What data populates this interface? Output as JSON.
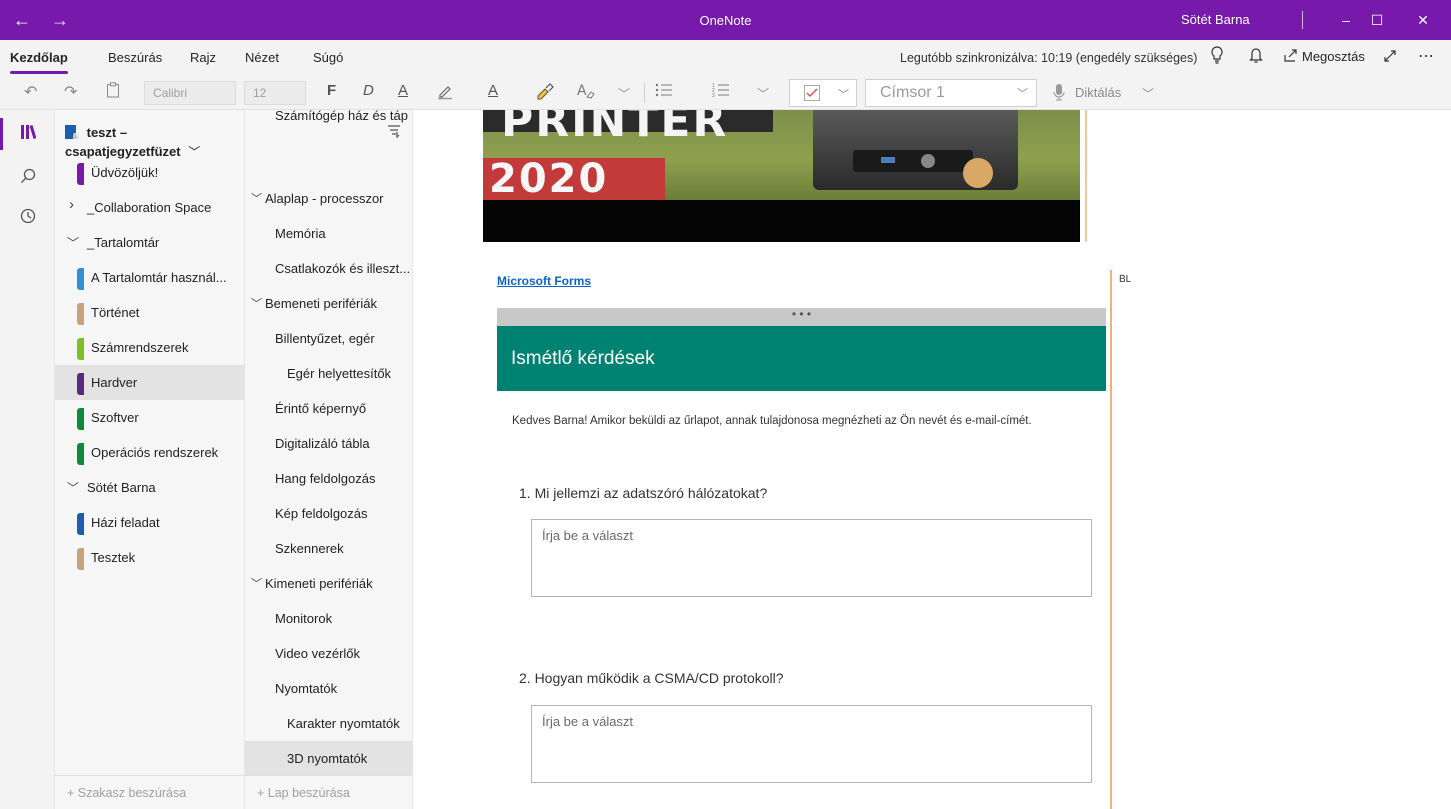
{
  "titlebar": {
    "app_title": "OneNote",
    "user_name": "Sötét Barna",
    "back_icon": "←",
    "forward_icon": "→",
    "minimize_icon": "–",
    "maximize_icon": "☐",
    "close_icon": "✕"
  },
  "menu": {
    "tabs": [
      "Kezdőlap",
      "Beszúrás",
      "Rajz",
      "Nézet",
      "Súgó"
    ],
    "sync_status": "Legutóbb szinkronizálva: 10:19 (engedély szükséges)",
    "share_label": "Megosztás"
  },
  "toolbar": {
    "font_name": "Calibri",
    "font_size": "12",
    "bold_label": "F",
    "italic_label": "D",
    "underline_label": "A",
    "font_color_label": "A",
    "style_value": "Címsor 1",
    "dictate_label": "Diktálás"
  },
  "notebook": {
    "name": "teszt – csapatjegyzetfüzet"
  },
  "sections": [
    {
      "label": "Üdvözöljük!",
      "color": "#7719aa",
      "indent": 1,
      "type": "section"
    },
    {
      "label": "_Collaboration Space",
      "indent": 0,
      "type": "group",
      "expanded": false
    },
    {
      "label": "_Tartalomtár",
      "indent": 0,
      "type": "group",
      "expanded": true
    },
    {
      "label": "A Tartalomtár használ...",
      "color": "#2f8fd8",
      "indent": 1,
      "type": "section"
    },
    {
      "label": "Történet",
      "color": "#c8a27a",
      "indent": 1,
      "type": "section"
    },
    {
      "label": "Számrendszerek",
      "color": "#7cc026",
      "indent": 1,
      "type": "section"
    },
    {
      "label": "Hardver",
      "color": "#5a2a7a",
      "indent": 1,
      "type": "section",
      "selected": true
    },
    {
      "label": "Szoftver",
      "color": "#0f8a3a",
      "indent": 1,
      "type": "section"
    },
    {
      "label": "Operációs rendszerek",
      "color": "#0f8a3a",
      "indent": 1,
      "type": "section"
    },
    {
      "label": "Sötét Barna",
      "indent": 0,
      "type": "group",
      "expanded": true
    },
    {
      "label": "Házi feladat",
      "color": "#1a5fb0",
      "indent": 1,
      "type": "section"
    },
    {
      "label": "Tesztek",
      "color": "#c8a27a",
      "indent": 1,
      "type": "section"
    }
  ],
  "add_section_label": "+ Szakasz beszúrása",
  "pages": [
    {
      "label": "Számítógép ház és táp...",
      "level": 1
    },
    {
      "label": "Alaplap - processzor",
      "level": 0,
      "expanded": true
    },
    {
      "label": "Memória",
      "level": 1
    },
    {
      "label": "Csatlakozók és illeszt...",
      "level": 1
    },
    {
      "label": "Bemeneti perifériák",
      "level": 0,
      "expanded": true
    },
    {
      "label": "Billentyűzet, egér",
      "level": 1
    },
    {
      "label": "Egér helyettesítők",
      "level": 2
    },
    {
      "label": "Érintő képernyő",
      "level": 1
    },
    {
      "label": "Digitalizáló tábla",
      "level": 1
    },
    {
      "label": "Hang feldolgozás",
      "level": 1
    },
    {
      "label": "Kép feldolgozás",
      "level": 1
    },
    {
      "label": "Szkennerek",
      "level": 1
    },
    {
      "label": "Kimeneti perifériák",
      "level": 0,
      "expanded": true
    },
    {
      "label": "Monitorok",
      "level": 1
    },
    {
      "label": "Video vezérlők",
      "level": 1
    },
    {
      "label": "Nyomtatók",
      "level": 1
    },
    {
      "label": "Karakter nyomtatók",
      "level": 2
    },
    {
      "label": "3D nyomtatók",
      "level": 2,
      "selected": true
    }
  ],
  "add_page_label": "+ Lap beszúrása",
  "canvas": {
    "image_text_top": "PRINTER",
    "image_text_year": "2020",
    "forms_link": "Microsoft Forms",
    "bl_tag": "BL",
    "form_grip": "• • •",
    "form_title": "Ismétlő kérdések",
    "form_intro": "Kedves Barna! Amikor beküldi az űrlapot, annak tulajdonosa megnézheti az Ön nevét és e-mail-címét.",
    "questions": [
      {
        "text": "1. Mi jellemzi az adatszóró hálózatokat?",
        "placeholder": "Írja be a választ"
      },
      {
        "text": "2. Hogyan működik a CSMA/CD protokoll?",
        "placeholder": "Írja be a választ"
      }
    ]
  },
  "colors": {
    "brand": "#7719aa",
    "form_header": "#008272",
    "link": "#0b63c5"
  }
}
